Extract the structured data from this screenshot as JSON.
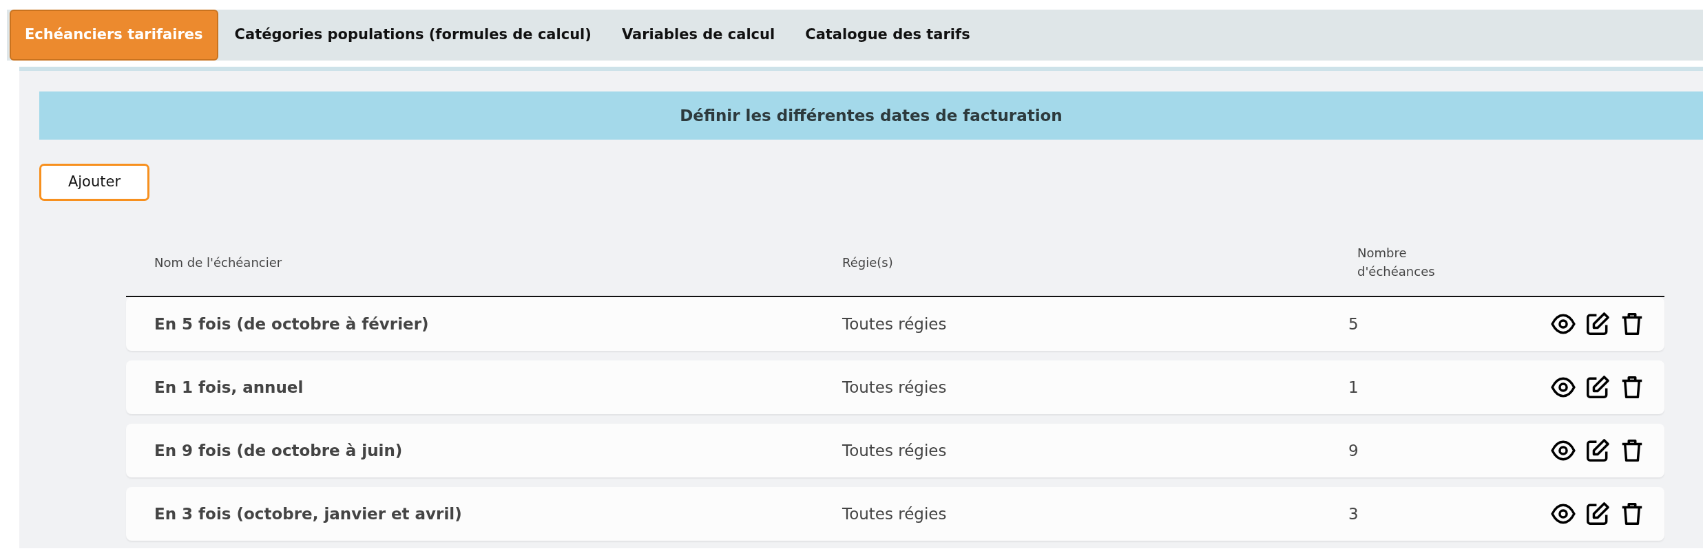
{
  "tabs": [
    {
      "label": "Echéanciers tarifaires",
      "selected": true
    },
    {
      "label": "Catégories populations (formules de calcul)",
      "selected": false
    },
    {
      "label": "Variables de calcul",
      "selected": false
    },
    {
      "label": "Catalogue des tarifs",
      "selected": false
    }
  ],
  "section_title": "Définir les différentes dates de facturation",
  "add_button": "Ajouter",
  "table": {
    "columns": [
      "Nom de l'échéancier",
      "Régie(s)",
      "Nombre d'échéances"
    ],
    "rows": [
      {
        "name": "En 5 fois (de octobre à février)",
        "regies": "Toutes régies",
        "count": "5"
      },
      {
        "name": "En 1 fois, annuel",
        "regies": "Toutes régies",
        "count": "1"
      },
      {
        "name": "En 9 fois (de octobre à juin)",
        "regies": "Toutes régies",
        "count": "9"
      },
      {
        "name": "En 3 fois (octobre, janvier et avril)",
        "regies": "Toutes régies",
        "count": "3"
      }
    ]
  }
}
